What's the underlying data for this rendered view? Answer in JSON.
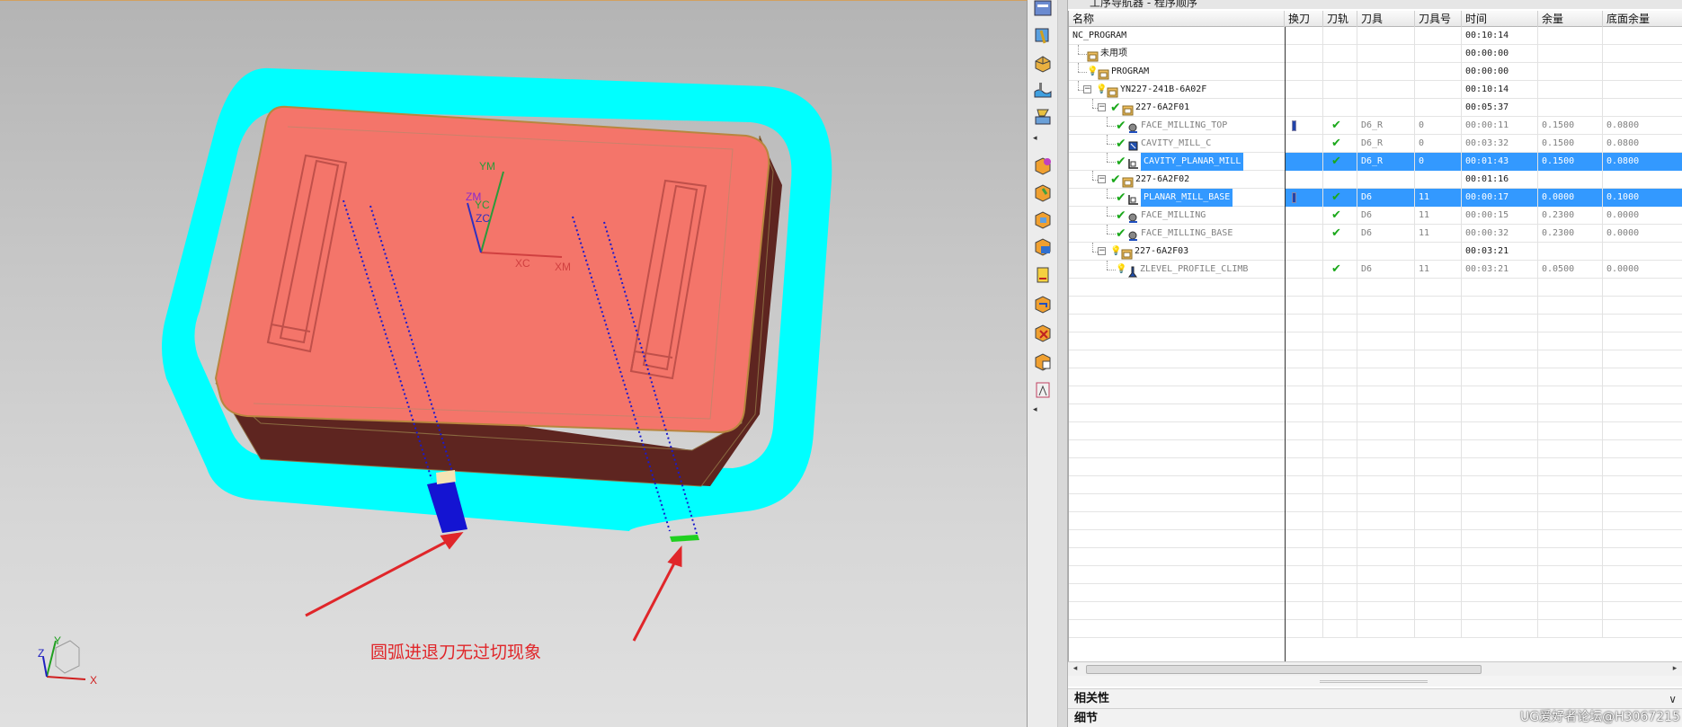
{
  "viewport": {
    "annotation": "圆弧进退刀无过切现象",
    "wcs_labels": {
      "ym": "YM",
      "zm": "ZM",
      "yc": "YC",
      "zc": "ZC",
      "xc": "XC",
      "xm": "XM"
    },
    "triad_labels": {
      "x": "X",
      "y": "Y",
      "z": "Z"
    },
    "colors": {
      "part_top": "#f4756a",
      "part_side": "#5e2520",
      "boundary": "#00ffff",
      "arrow": "#e0262a",
      "toolpath": "#1a1acc"
    }
  },
  "toolbar": {
    "icons": [
      "operation-navigator-icon",
      "tool-navigator-icon",
      "geometry-navigator-icon",
      "machining-method-icon",
      "feature-navigator-icon",
      "create-program-icon",
      "create-tool-icon",
      "create-geometry-icon",
      "create-method-icon",
      "create-operation-icon",
      "generate-toolpath-icon",
      "verify-toolpath-icon",
      "delete-toolpath-icon",
      "postprocess-icon",
      "shop-docs-icon"
    ]
  },
  "navigator": {
    "title": "工序导航器 - 程序顺序",
    "columns": [
      "名称",
      "换刀",
      "刀轨",
      "刀具",
      "刀具号",
      "时间",
      "余量",
      "底面余量"
    ],
    "rows": [
      {
        "name": "NC_PROGRAM",
        "level": 0,
        "tool": "",
        "tool_no": "",
        "time": "00:10:14",
        "stock": "",
        "floor": "",
        "status": "none",
        "toolchange": false,
        "path": false,
        "style": "dark",
        "selected": false,
        "expander": false,
        "icon": "none"
      },
      {
        "name": "未用项",
        "level": 1,
        "tool": "",
        "tool_no": "",
        "time": "00:00:00",
        "stock": "",
        "floor": "",
        "status": "none",
        "toolchange": false,
        "path": false,
        "style": "dark",
        "selected": false,
        "expander": false,
        "icon": "group"
      },
      {
        "name": "PROGRAM",
        "level": 1,
        "tool": "",
        "tool_no": "",
        "time": "00:00:00",
        "stock": "",
        "floor": "",
        "status": "bulb",
        "toolchange": false,
        "path": false,
        "style": "dark",
        "selected": false,
        "expander": false,
        "icon": "group"
      },
      {
        "name": "YN227-241B-6A02F",
        "level": 1,
        "tool": "",
        "tool_no": "",
        "time": "00:10:14",
        "stock": "",
        "floor": "",
        "status": "bulb",
        "toolchange": false,
        "path": false,
        "style": "dark",
        "selected": false,
        "expander": true,
        "icon": "group"
      },
      {
        "name": "227-6A2F01",
        "level": 2,
        "tool": "",
        "tool_no": "",
        "time": "00:05:37",
        "stock": "",
        "floor": "",
        "status": "check",
        "toolchange": false,
        "path": false,
        "style": "dark",
        "selected": false,
        "expander": true,
        "icon": "group"
      },
      {
        "name": "FACE_MILLING_TOP",
        "level": 3,
        "tool": "D6_R",
        "tool_no": "0",
        "time": "00:00:11",
        "stock": "0.1500",
        "floor": "0.0800",
        "status": "check",
        "toolchange": true,
        "path": true,
        "style": "grey",
        "selected": false,
        "expander": false,
        "icon": "face"
      },
      {
        "name": "CAVITY_MILL_C",
        "level": 3,
        "tool": "D6_R",
        "tool_no": "0",
        "time": "00:03:32",
        "stock": "0.1500",
        "floor": "0.0800",
        "status": "check",
        "toolchange": false,
        "path": true,
        "style": "grey",
        "selected": false,
        "expander": false,
        "icon": "cavity"
      },
      {
        "name": "CAVITY_PLANAR_MILL",
        "level": 3,
        "tool": "D6_R",
        "tool_no": "0",
        "time": "00:01:43",
        "stock": "0.1500",
        "floor": "0.0800",
        "status": "check",
        "toolchange": false,
        "path": true,
        "style": "grey",
        "selected": true,
        "expander": false,
        "icon": "planar"
      },
      {
        "name": "227-6A2F02",
        "level": 2,
        "tool": "",
        "tool_no": "",
        "time": "00:01:16",
        "stock": "",
        "floor": "",
        "status": "check",
        "toolchange": false,
        "path": false,
        "style": "dark",
        "selected": false,
        "expander": true,
        "icon": "group"
      },
      {
        "name": "PLANAR_MILL_BASE",
        "level": 3,
        "tool": "D6",
        "tool_no": "11",
        "time": "00:00:17",
        "stock": "0.0000",
        "floor": "0.1000",
        "status": "check",
        "toolchange": true,
        "path": true,
        "style": "grey",
        "selected": true,
        "expander": false,
        "icon": "planar"
      },
      {
        "name": "FACE_MILLING",
        "level": 3,
        "tool": "D6",
        "tool_no": "11",
        "time": "00:00:15",
        "stock": "0.2300",
        "floor": "0.0000",
        "status": "check",
        "toolchange": false,
        "path": true,
        "style": "grey",
        "selected": false,
        "expander": false,
        "icon": "face"
      },
      {
        "name": "FACE_MILLING_BASE",
        "level": 3,
        "tool": "D6",
        "tool_no": "11",
        "time": "00:00:32",
        "stock": "0.2300",
        "floor": "0.0000",
        "status": "check",
        "toolchange": false,
        "path": true,
        "style": "grey",
        "selected": false,
        "expander": false,
        "icon": "face"
      },
      {
        "name": "227-6A2F03",
        "level": 2,
        "tool": "",
        "tool_no": "",
        "time": "00:03:21",
        "stock": "",
        "floor": "",
        "status": "bulb",
        "toolchange": false,
        "path": false,
        "style": "dark",
        "selected": false,
        "expander": true,
        "icon": "group"
      },
      {
        "name": "ZLEVEL_PROFILE_CLIMB",
        "level": 3,
        "tool": "D6",
        "tool_no": "11",
        "time": "00:03:21",
        "stock": "0.0500",
        "floor": "0.0000",
        "status": "bulb",
        "toolchange": false,
        "path": true,
        "style": "grey",
        "selected": false,
        "expander": false,
        "icon": "zlevel"
      }
    ],
    "sections": {
      "dependencies": "相关性",
      "details": "细节"
    }
  },
  "watermark": "UG爱好者论坛@H3067215"
}
